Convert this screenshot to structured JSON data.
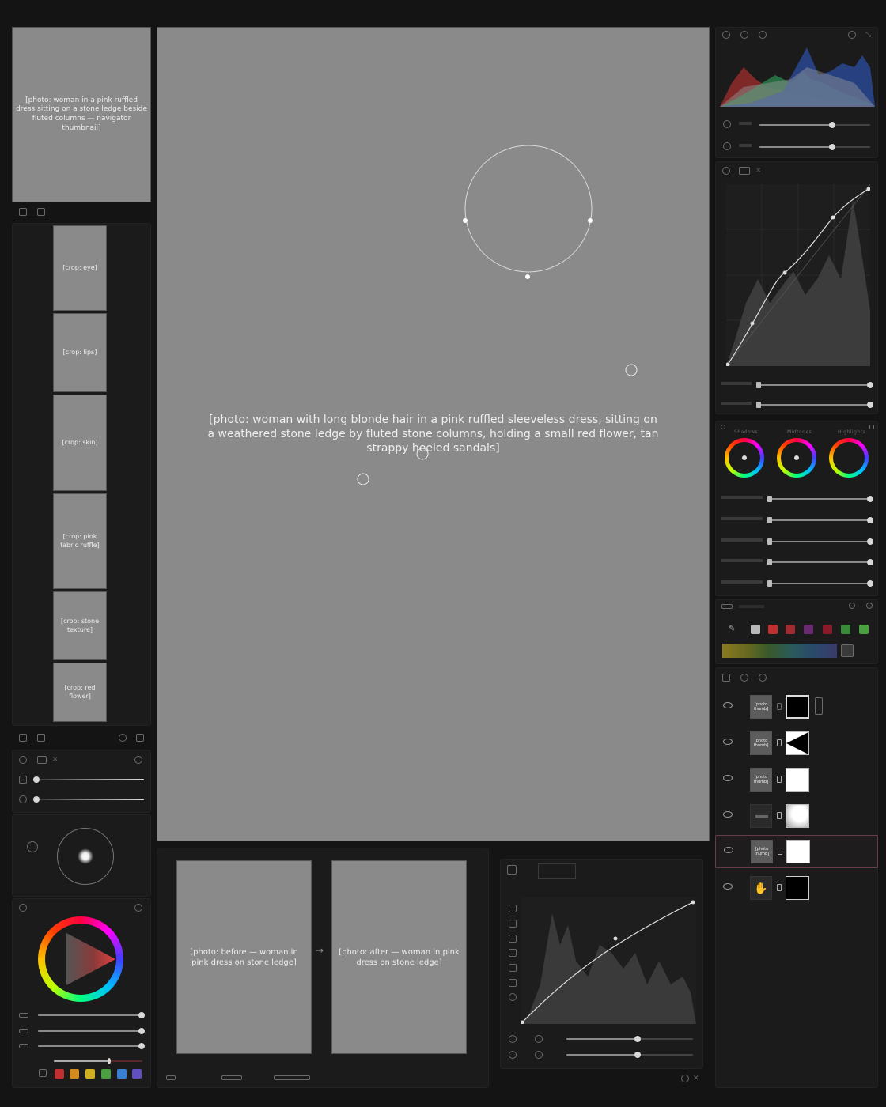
{
  "images": {
    "navigator": "[photo: woman in a pink ruffled dress sitting on a stone ledge beside fluted columns — navigator thumbnail]",
    "main_canvas": "[photo: woman with long blonde hair in a pink ruffled sleeveless dress, sitting on a weathered stone ledge by fluted stone columns, holding a small red flower, tan strappy heeled sandals]",
    "detail_crops": [
      "[crop: eye]",
      "[crop: lips]",
      "[crop: skin]",
      "[crop: pink fabric ruffle]",
      "[crop: stone texture]",
      "[crop: red flower]"
    ],
    "before": "[photo: before — woman in pink dress on stone ledge]",
    "after": "[photo: after — woman in pink dress on stone ledge]",
    "layer_thumb": "[photo thumb]"
  },
  "color_wheels": {
    "labels": [
      "Shadows",
      "Midtones",
      "Highlights"
    ]
  },
  "sliders": {
    "histogram_panel": [
      0.7,
      0.7
    ],
    "curves_panel": [
      1.0,
      1.0
    ],
    "grading_panel": [
      1.0,
      1.0,
      1.0,
      1.0,
      1.0
    ],
    "left_tone": [
      1.0,
      1.0
    ],
    "left_color": [
      1.0,
      1.0,
      1.0
    ],
    "bottom_curve": [
      0.55,
      0.55
    ]
  },
  "swatch_colors": [
    "#b8b8b8",
    "#c03030",
    "#a02a30",
    "#6a2a70",
    "#8a1a2a",
    "#3a8a3a",
    "#4aa040"
  ],
  "bottom_swatches": [
    "#c03030",
    "#d08a20",
    "#d0b020",
    "#4aa040",
    "#3a80d0",
    "#6050c0"
  ],
  "layers": [
    {
      "mask": "black-frame",
      "selected": false
    },
    {
      "mask": "triangle",
      "selected": false
    },
    {
      "mask": "white",
      "selected": false
    },
    {
      "mask": "white-soft",
      "selected": false
    },
    {
      "mask": "white",
      "selected": true
    },
    {
      "mask": "black",
      "selected": false
    }
  ],
  "icons": [
    "eye-icon",
    "link-icon",
    "gear-icon",
    "compare-arrow-icon",
    "eyedropper-icon",
    "brush-icon",
    "pen-icon",
    "histogram-icon",
    "reset-icon",
    "expand-icon"
  ]
}
